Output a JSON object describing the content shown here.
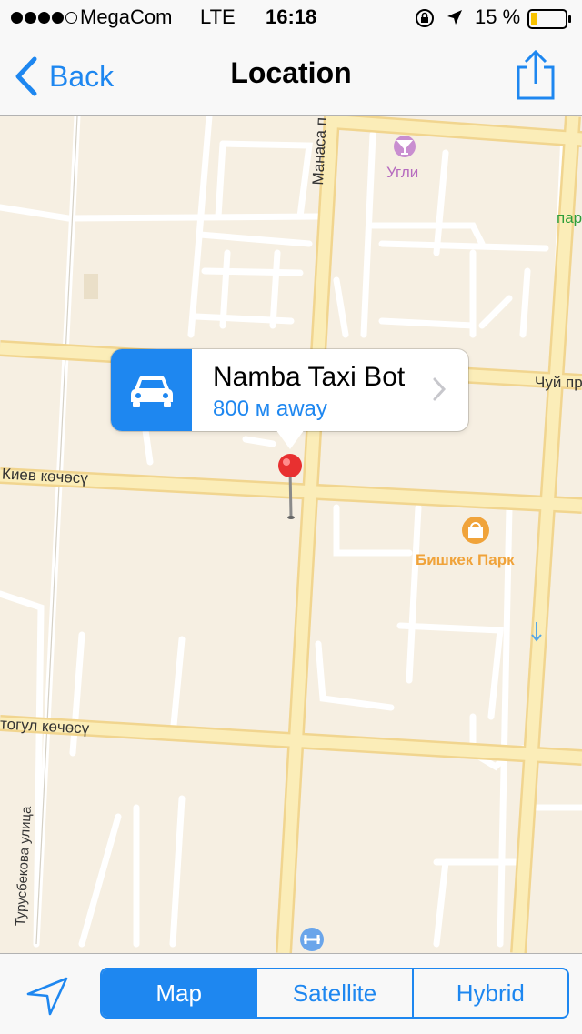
{
  "status": {
    "carrier": "MegaCom",
    "network": "LTE",
    "time": "16:18",
    "battery": "15 %"
  },
  "navbar": {
    "back_label": "Back",
    "title": "Location"
  },
  "map": {
    "labels": {
      "manasa": "Манаса п",
      "ugli": "Угли",
      "par": "пар",
      "chuy": "Чуй пр",
      "kiev": "Киев көчөсү",
      "bishkek_park": "Бишкек Парк",
      "togul": "тогул көчөсү",
      "tursbekov": "Турусбекова улица"
    }
  },
  "callout": {
    "name": "Namba Taxi Bot",
    "distance": "800 м away"
  },
  "toolbar": {
    "segments": [
      "Map",
      "Satellite",
      "Hybrid"
    ],
    "selected": "Map"
  },
  "colors": {
    "accent": "#1e87f0",
    "pin": "#e83030",
    "road": "#fae9a8"
  }
}
